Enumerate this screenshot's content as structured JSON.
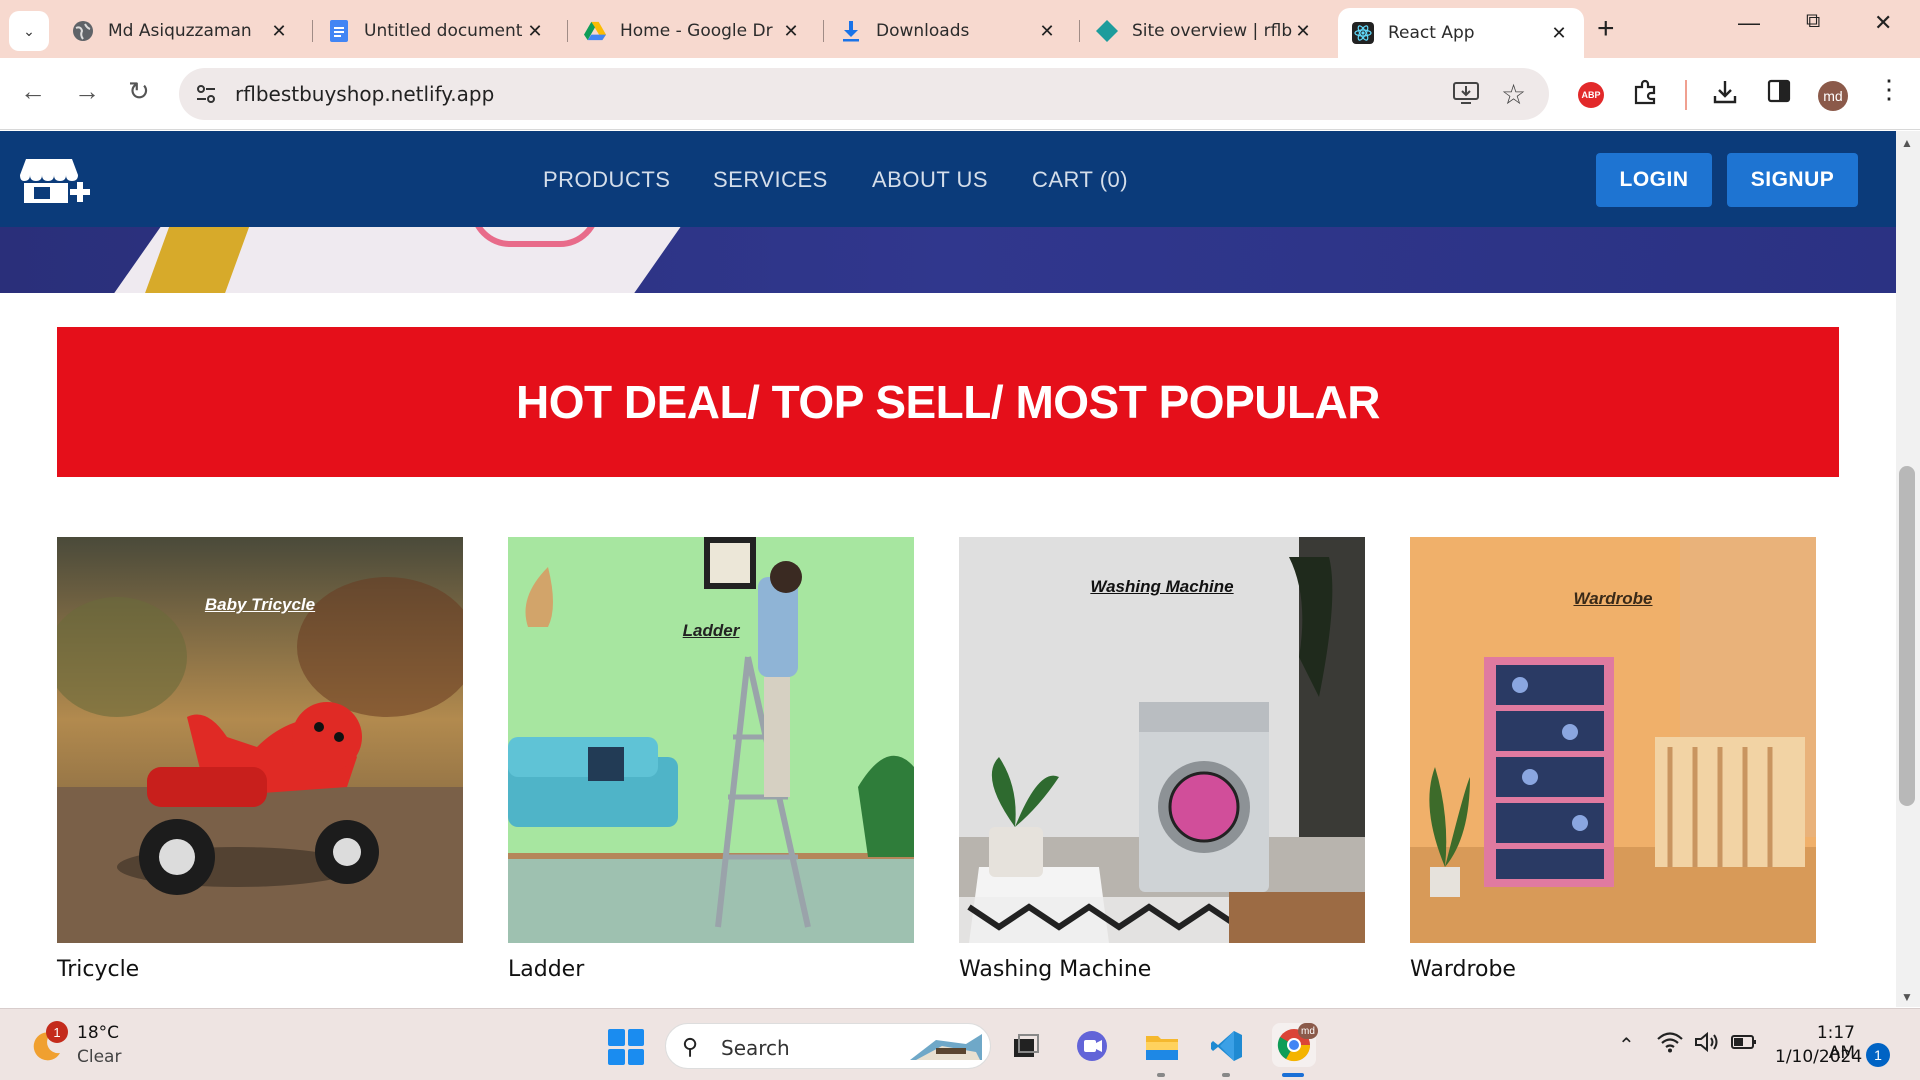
{
  "browser": {
    "tabs": [
      {
        "title": "Md Asiquzzaman",
        "icon": "globe-icon"
      },
      {
        "title": "Untitled document",
        "icon": "google-docs-icon"
      },
      {
        "title": "Home - Google Dr",
        "icon": "google-drive-icon"
      },
      {
        "title": "Downloads",
        "icon": "download-icon"
      },
      {
        "title": "Site overview | rflb",
        "icon": "netlify-icon"
      },
      {
        "title": "React App",
        "icon": "react-icon"
      }
    ],
    "active_tab": 5,
    "url": "rflbestbuyshop.netlify.app",
    "profile_initials": "md",
    "abp_label": "ABP"
  },
  "site": {
    "nav": {
      "links": [
        "PRODUCTS",
        "SERVICES",
        "ABOUT US",
        "CART (0)"
      ],
      "login_label": "LOGIN",
      "signup_label": "SIGNUP"
    },
    "section_title": "HOT DEAL/ TOP SELL/ MOST POPULAR",
    "products": [
      {
        "name": "Tricycle",
        "image_caption": "Baby Tricycle"
      },
      {
        "name": "Ladder",
        "image_caption": "Ladder"
      },
      {
        "name": "Washing Machine",
        "image_caption": "Washing Machine"
      },
      {
        "name": "Wardrobe",
        "image_caption": "Wardrobe"
      }
    ],
    "colors": {
      "nav_bg": "#0b3b7a",
      "accent_red": "#e50f1a",
      "button_blue": "#1e74d2"
    }
  },
  "taskbar": {
    "weather": {
      "temp": "18°C",
      "condition": "Clear",
      "badge": "1"
    },
    "search_placeholder": "Search",
    "clock": {
      "time": "1:17 AM",
      "date": "1/10/2024"
    },
    "notification_count": "1",
    "profile_badge": "md"
  }
}
